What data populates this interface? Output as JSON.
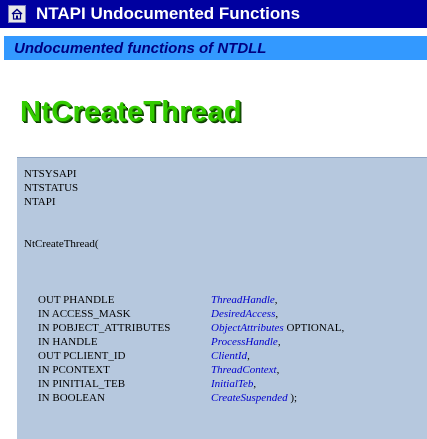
{
  "header": {
    "title": "NTAPI Undocumented Functions",
    "home_icon": "home-icon"
  },
  "subtitle": "Undocumented functions of NTDLL",
  "function_name": "NtCreateThread",
  "colors": {
    "title_bar": "#0000a0",
    "subtitle_bar": "#3399ff",
    "heading_green": "#33cc00",
    "code_background": "#b6c8de",
    "param_name_blue": "#0000cc"
  },
  "code": {
    "decl": [
      "NTSYSAPI",
      "NTSTATUS",
      "NTAPI"
    ],
    "call": "NtCreateThread(",
    "params": [
      {
        "type": "OUT PHANDLE",
        "name": "ThreadHandle",
        "suffix": ","
      },
      {
        "type": "IN ACCESS_MASK",
        "name": "DesiredAccess",
        "suffix": ","
      },
      {
        "type": "IN POBJECT_ATTRIBUTES",
        "name": "ObjectAttributes",
        "suffix": " OPTIONAL,"
      },
      {
        "type": "IN HANDLE",
        "name": "ProcessHandle",
        "suffix": ","
      },
      {
        "type": "OUT PCLIENT_ID",
        "name": "ClientId",
        "suffix": ","
      },
      {
        "type": "IN PCONTEXT",
        "name": "ThreadContext",
        "suffix": ","
      },
      {
        "type": "IN PINITIAL_TEB",
        "name": "InitialTeb",
        "suffix": ","
      },
      {
        "type": "IN BOOLEAN",
        "name": "CreateSuspended",
        "suffix": " );"
      }
    ]
  }
}
